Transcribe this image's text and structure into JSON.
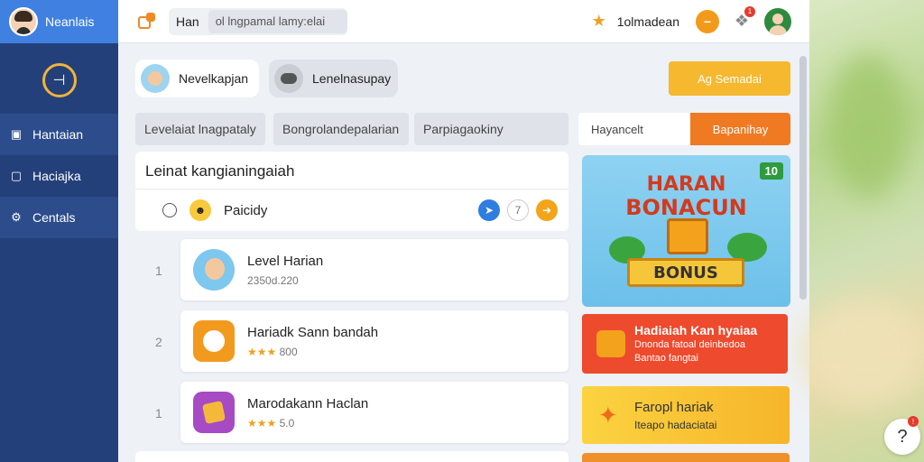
{
  "sidebar": {
    "title": "Neanlais",
    "logo_glyph": "⊣",
    "items": [
      {
        "label": "Hantaian",
        "icon": "puzzle-icon"
      },
      {
        "label": "Haciajka",
        "icon": "frame-icon"
      },
      {
        "label": "Centals",
        "icon": "gear-icon"
      }
    ]
  },
  "topbar": {
    "search_label": "Han",
    "search_placeholder": "ol lngpamal lamy:elai",
    "user_name": "1olmadean",
    "notif_count": "1"
  },
  "chips": [
    {
      "label": "Nevelkapjan"
    },
    {
      "label": "Lenelnasupay"
    }
  ],
  "search_button": "Ag Semadai",
  "tabs": [
    "Levelaiat lnagpataly",
    "Bongrolandepalarian",
    "Parpiagaokiny"
  ],
  "segment": {
    "left": "Hayancelt",
    "right": "Bapanihay"
  },
  "panel": {
    "title": "Leinat kangianingaiah",
    "row_label": "Paicidy",
    "icon_white_label": "7"
  },
  "list": [
    {
      "rank": "1",
      "title": "Level Harian",
      "sub": "2350d.220",
      "stars": ""
    },
    {
      "rank": "2",
      "title": "Hariadk Sann bandah",
      "sub": "800",
      "stars": "★★★"
    },
    {
      "rank": "1",
      "title": "Marodakann Haclan",
      "sub": "5.0",
      "stars": "★★★"
    }
  ],
  "promo": {
    "count": "10",
    "line1": "HARAN",
    "line2": "BONACUN",
    "ribbon": "BONUS"
  },
  "card_red": {
    "title": "Hadiaiah Kan hyaiaa",
    "sub1": "Dnonda fatoal deinbedoa",
    "sub2": "Bantao fangtai"
  },
  "card_yellow": {
    "title": "Faropl hariak",
    "sub": "Iteapo hadaciatai"
  },
  "help": {
    "glyph": "?",
    "badge": "!"
  },
  "colors": {
    "sidebar": "#24407a",
    "sidebar_header": "#3f80e0",
    "accent_orange": "#f07a22",
    "accent_yellow": "#f5b82e",
    "card_red": "#ee4a2e"
  }
}
